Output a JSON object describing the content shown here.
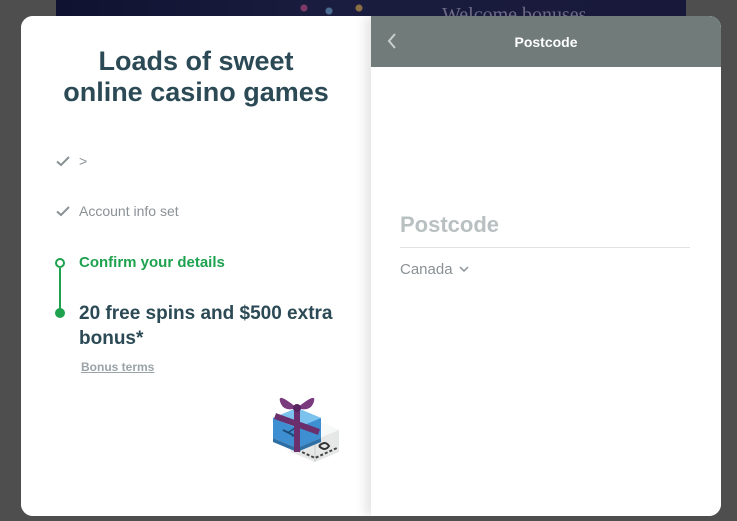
{
  "background": {
    "headline_fragment": "Welcome bonuses"
  },
  "modal": {
    "left": {
      "headline_line1": "Loads of sweet",
      "headline_line2": "online casino games",
      "steps": [
        {
          "label": ">",
          "status": "done",
          "icon": "check-icon"
        },
        {
          "label": "Account info set",
          "status": "done",
          "icon": "check-icon"
        },
        {
          "label": "Confirm your details",
          "status": "active",
          "icon": "step-dot-outline-icon"
        }
      ],
      "bonus_title": "20 free spins and $500 extra bonus*",
      "bonus_terms_link": "Bonus terms",
      "gift_icon": "gift-box-icon"
    },
    "right": {
      "header_title": "Postcode",
      "back_icon": "chevron-left-icon",
      "postcode_placeholder": "Postcode",
      "postcode_value": "",
      "country_selected": "Canada",
      "country_icon": "chevron-down-icon"
    }
  },
  "colors": {
    "primary_text": "#2b4a55",
    "accent_green": "#1ea24f",
    "header_grey": "#707b7a",
    "muted_text": "#8a9195"
  }
}
